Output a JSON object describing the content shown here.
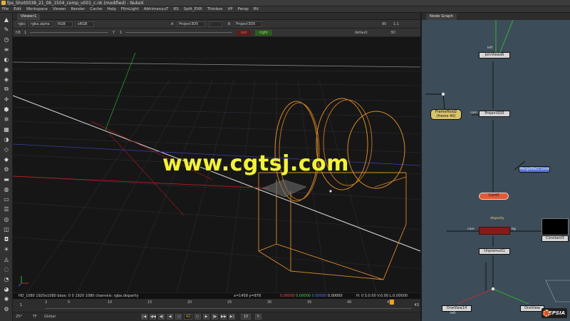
{
  "window": {
    "title": "fps_Shot0038_21_06_1504_comp_v001_c.nk (modified) - NukeX"
  },
  "menu": [
    "File",
    "Edit",
    "Workspace",
    "Viewer",
    "Render",
    "Cache",
    "Help",
    "FilmLight",
    "AbhimanyuT",
    "RS",
    "Split_EXR",
    "Thinbox",
    "VP",
    "Persp",
    "RV"
  ],
  "viewer": {
    "tab": "Viewer1",
    "channels": "rgba",
    "alpha": "rgba.alpha",
    "colorspace": "RGB",
    "lut": "sRGB",
    "input_a_label": "A",
    "input_a": "Project3D5",
    "input_b_label": "B",
    "input_b": "Project3D5",
    "gain_label": "f/8",
    "gain_value": "1",
    "gamma_label": "Y",
    "gamma_value": "1",
    "red_button": "red",
    "green_button": "right",
    "frame_label": "default",
    "view_mode": "3D",
    "zoom_label": "90",
    "zoom_ratio": "1:1",
    "watermark": "www.cgtsj.com",
    "info": "HD_1080 1920x1080  bbox: 0 0 1920 1080 channels: rgba.disparity",
    "coords": "x=1458 y=878",
    "rgba_r": "0.00000",
    "rgba_g": "0.00000",
    "rgba_b": "0.00000",
    "rgba_a": "0.00000",
    "hsvl": "H: 0 S:0.00 V:0.00  L:0.00000",
    "timeline_start": "1",
    "timeline_end": "43",
    "ticks": [
      "2",
      "5",
      "10",
      "15",
      "20",
      "25",
      "30",
      "35",
      "40",
      "45"
    ],
    "current_frame": "42",
    "fps": "25*",
    "tf": "TF",
    "global": "Global",
    "increment": "10"
  },
  "node_graph": {
    "tab": "Node Graph",
    "nodes": {
      "joinviews": "JoinViews6",
      "framehold": "FrameHold2",
      "framehold_sub": "(frame 40)",
      "project3d": "Project3D5",
      "mergemat": "MergeMat2 (over)",
      "card": "Card3",
      "scene": "",
      "constant": "Constant3",
      "unpremult": "Unpremult1",
      "oneview_left": "OneView14",
      "oneview_right": "OneView"
    },
    "labels": {
      "left": "left",
      "cam": "cam",
      "img": "img",
      "disparity": "disparity",
      "bg": "bg"
    }
  },
  "colors": {
    "node_graph_bg": "#3c4c58",
    "viewer_bg": "#161616",
    "watermark": "#f2f23a",
    "selected_node": "#e15a3a",
    "framehold": "#d9c36a",
    "mergemat": "#5a78d8",
    "current_frame": "#f0a21f"
  },
  "logo_text": "DEPSIA"
}
